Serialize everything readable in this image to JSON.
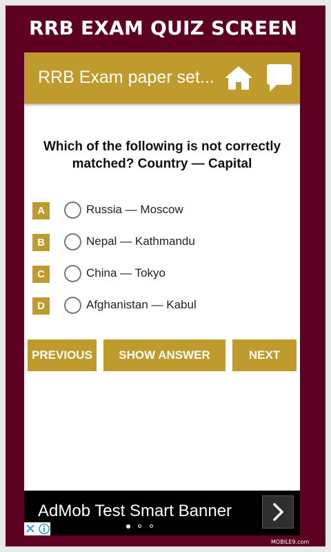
{
  "screen_title": "RRB EXAM QUIZ SCREEN",
  "app_bar": {
    "title": "RRB Exam paper set...",
    "home_icon": "home-icon",
    "chat_icon": "chat-bubble-icon"
  },
  "question": "Which of the following is not correctly matched? Country — Capital",
  "options": [
    {
      "letter": "A",
      "text": "Russia — Moscow"
    },
    {
      "letter": "B",
      "text": "Nepal — Kathmandu"
    },
    {
      "letter": "C",
      "text": "China — Tokyo"
    },
    {
      "letter": "D",
      "text": "Afghanistan — Kabul"
    }
  ],
  "buttons": {
    "previous": "PREVIOUS",
    "show_answer": "SHOW ANSWER",
    "next": "NEXT"
  },
  "ad": {
    "text": "AdMob Test Smart Banner",
    "pager_active": 0,
    "pager_count": 3
  },
  "watermark": "MOBILE9.com",
  "colors": {
    "frame": "#5e0022",
    "accent": "#bf9a2c",
    "text": "#111111"
  }
}
